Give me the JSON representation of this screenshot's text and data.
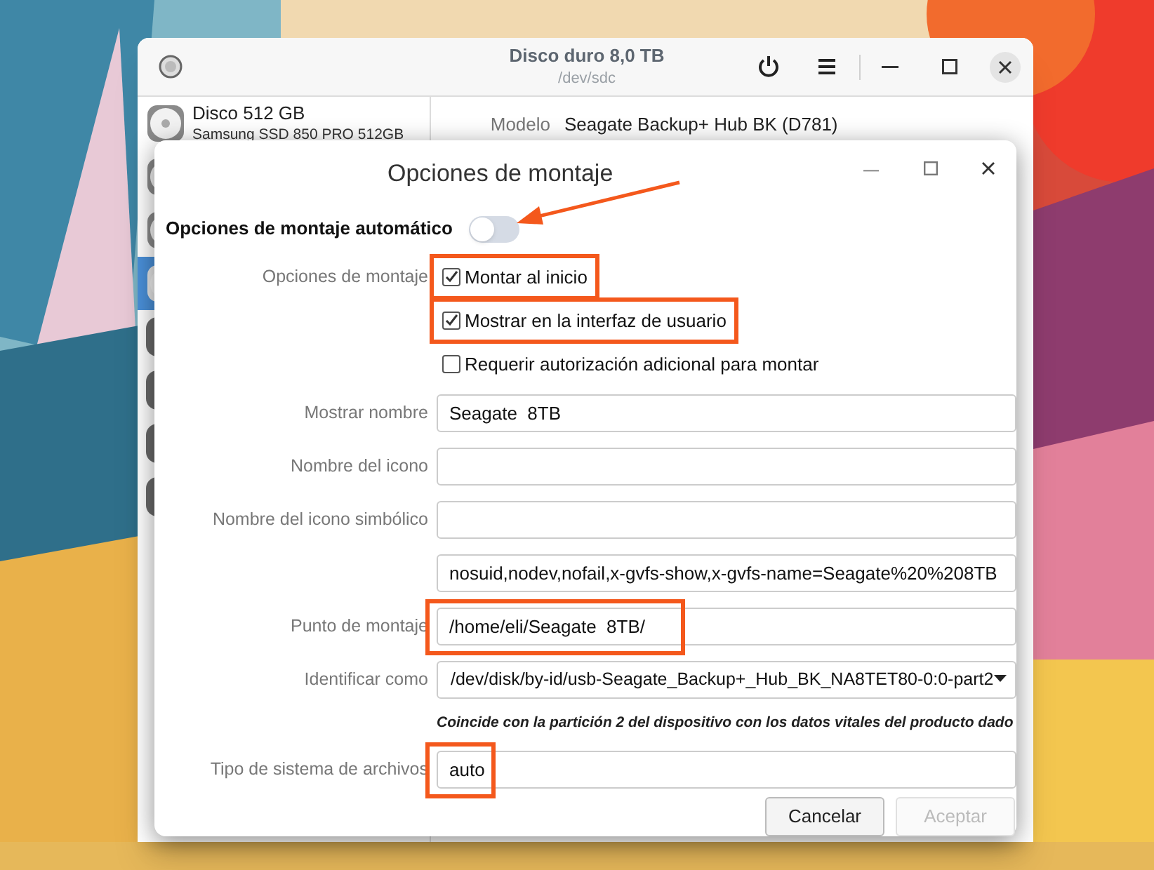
{
  "main_window": {
    "title": "Disco duro 8,0 TB",
    "subtitle": "/dev/sdc",
    "disks": [
      {
        "kind": "disc",
        "name": "Disco 512 GB",
        "detail": "Samsung SSD 850 PRO 512GB",
        "selected": false
      },
      {
        "kind": "disc",
        "selected": false
      },
      {
        "kind": "disc",
        "selected": false
      },
      {
        "kind": "disc",
        "selected": true
      },
      {
        "kind": "drive",
        "selected": false
      },
      {
        "kind": "drive",
        "selected": false
      },
      {
        "kind": "drive",
        "selected": false
      },
      {
        "kind": "drive",
        "selected": false
      }
    ],
    "details": [
      {
        "label": "Modelo",
        "value": "Seagate Backup+ Hub BK (D781)"
      }
    ]
  },
  "dialog": {
    "title": "Opciones de montaje",
    "auto_mount": {
      "label": "Opciones de montaje automático",
      "on": false,
      "arrow": true
    },
    "mount_options": {
      "label": "Opciones de montaje",
      "checkboxes": [
        {
          "label": "Montar al inicio",
          "checked": true,
          "highlighted": true
        },
        {
          "label": "Mostrar en la interfaz de usuario",
          "checked": true,
          "highlighted": true
        },
        {
          "label": "Requerir autorización adicional para montar",
          "checked": false,
          "highlighted": false
        }
      ]
    },
    "fields": [
      {
        "kind": "entry",
        "label": "Mostrar nombre",
        "value": "Seagate  8TB",
        "highlighted": false
      },
      {
        "kind": "entry",
        "label": "Nombre del icono",
        "highlighted": false
      },
      {
        "kind": "entry",
        "label": "Nombre del icono simbólico",
        "highlighted": false
      },
      {
        "kind": "entry",
        "value": "nosuid,nodev,nofail,x-gvfs-show,x-gvfs-name=Seagate%20%208TB",
        "highlighted": false
      },
      {
        "kind": "entry",
        "label": "Punto de montaje",
        "value": "/home/eli/Seagate  8TB/",
        "highlighted": true
      },
      {
        "kind": "dropdown",
        "label": "Identificar como",
        "value": "/dev/disk/by-id/usb-Seagate_Backup+_Hub_BK_NA8TET80-0:0-part2",
        "hint": "Coincide con la partición 2 del dispositivo con los datos vitales del producto dado",
        "highlighted": false
      },
      {
        "kind": "entry",
        "label": "Tipo de sistema de archivos",
        "value": "auto",
        "highlighted": true
      }
    ],
    "buttons": [
      {
        "label": "Cancelar",
        "disabled": false
      },
      {
        "label": "Aceptar",
        "disabled": true
      }
    ]
  }
}
